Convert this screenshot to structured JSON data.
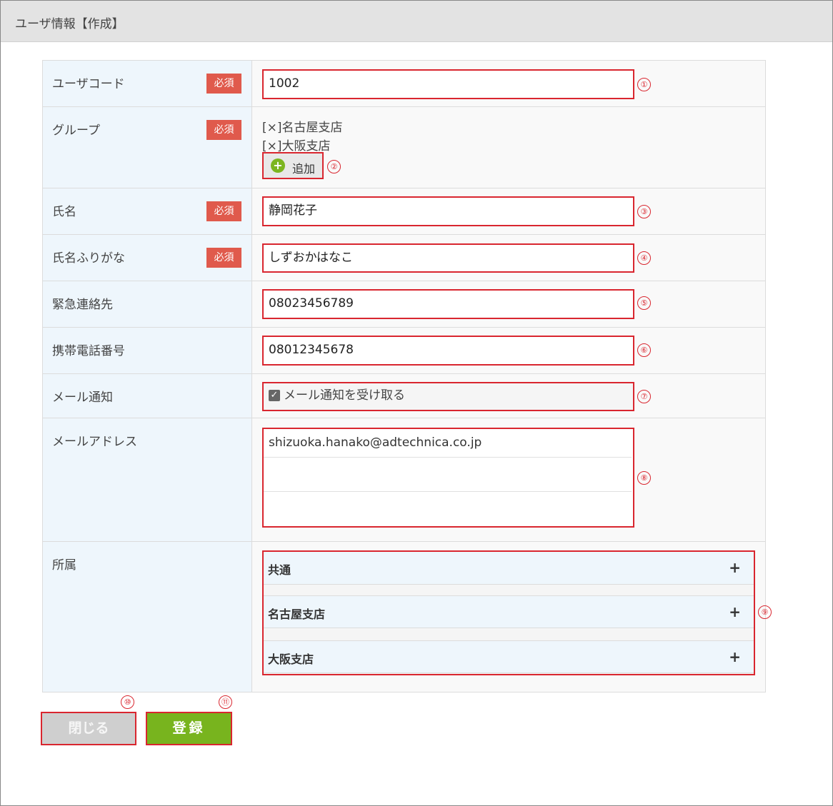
{
  "title": "ユーザ情報【作成】",
  "required_label": "必須",
  "fields": {
    "user_code": {
      "label": "ユーザコード",
      "value": "1002"
    },
    "group": {
      "label": "グループ",
      "items": [
        "[×]名古屋支店",
        "[×]大阪支店"
      ],
      "add_label": "追加"
    },
    "name": {
      "label": "氏名",
      "value": "静岡花子"
    },
    "name_kana": {
      "label": "氏名ふりがな",
      "value": "しずおかはなこ"
    },
    "emergency": {
      "label": "緊急連絡先",
      "value": "08023456789"
    },
    "mobile": {
      "label": "携帯電話番号",
      "value": "08012345678"
    },
    "mail_notify": {
      "label": "メール通知",
      "checkbox_label": "メール通知を受け取る",
      "checked": true
    },
    "email": {
      "label": "メールアドレス",
      "values": [
        "shizuoka.hanako@adtechnica.co.jp",
        "",
        ""
      ]
    },
    "affiliation": {
      "label": "所属",
      "items": [
        "共通",
        "名古屋支店",
        "大阪支店"
      ],
      "expand_icon": "+"
    }
  },
  "callouts": [
    "①",
    "②",
    "③",
    "④",
    "⑤",
    "⑥",
    "⑦",
    "⑧",
    "⑨",
    "⑩",
    "⑪"
  ],
  "buttons": {
    "close": "閉じる",
    "register": "登録"
  },
  "colors": {
    "highlight": "#d9262f",
    "required_bg": "#e05a4c",
    "register_bg": "#78b41e",
    "add_icon": "#7cb520"
  }
}
